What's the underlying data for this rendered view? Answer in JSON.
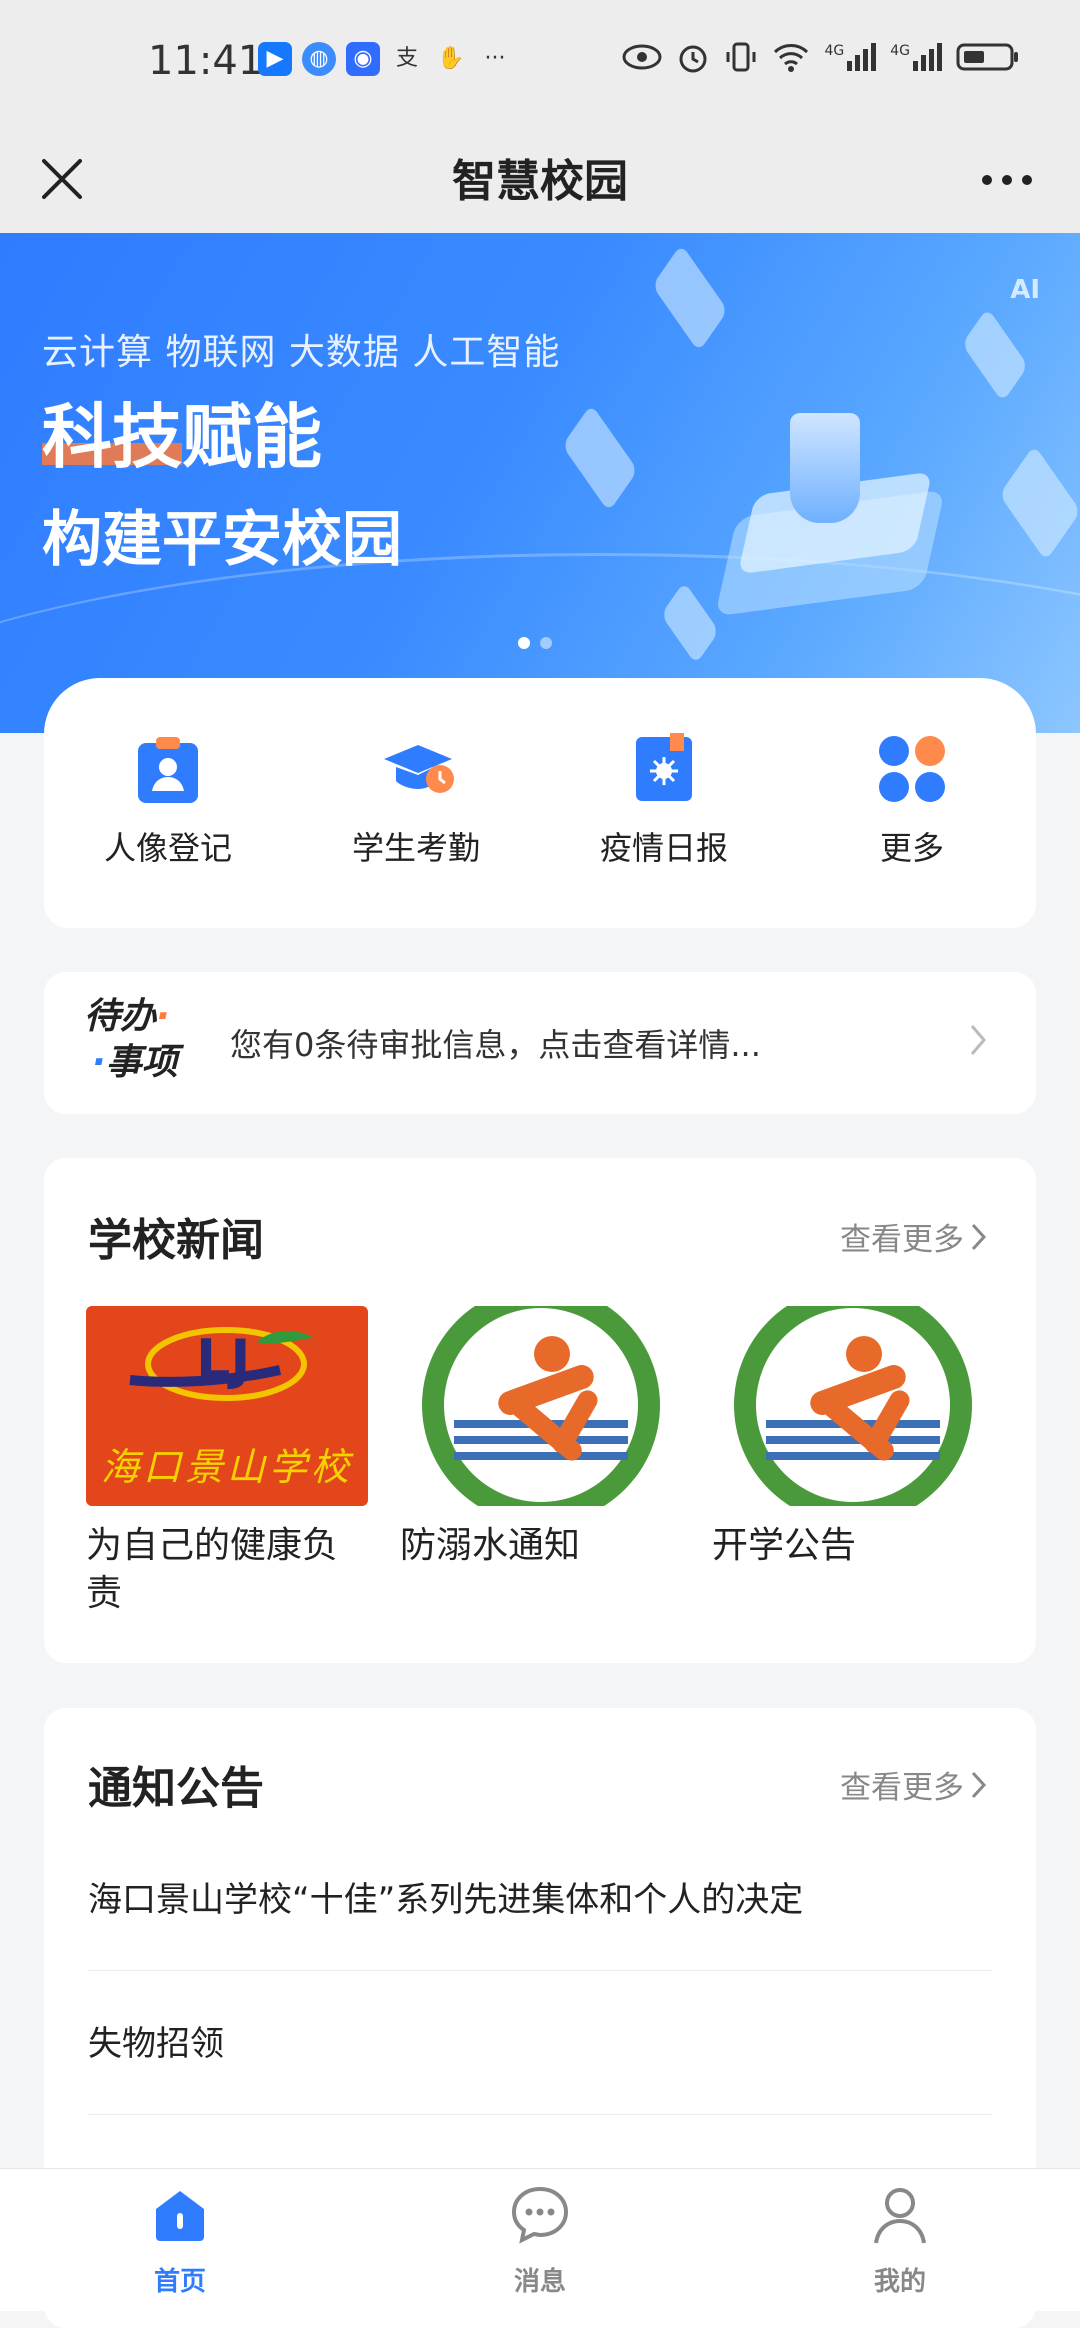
{
  "status_bar": {
    "time": "11:41",
    "left_icons": [
      "app-notification-icon",
      "browser-icon",
      "app-icon",
      "alipay-icon",
      "hand-icon",
      "more-dots"
    ],
    "right_icons": [
      "eye-icon",
      "alarm-icon",
      "vibrate-icon",
      "wifi-icon",
      "signal-4g-icon",
      "signal-4g-icon",
      "battery-icon"
    ],
    "overflow": "···",
    "net1": "4G",
    "net2": "4G"
  },
  "header": {
    "title": "智慧校园"
  },
  "banner": {
    "subtitle": "云计算 物联网 大数据 人工智能",
    "headline": "科技赋能",
    "headline2": "构建平安校园",
    "logo_text": "AI",
    "page_count": 2,
    "active_page": 1
  },
  "quick_menu": [
    {
      "label": "人像登记",
      "icon": "portrait-register-icon"
    },
    {
      "label": "学生考勤",
      "icon": "graduation-cap-clock-icon"
    },
    {
      "label": "疫情日报",
      "icon": "epidemic-report-icon"
    },
    {
      "label": "更多",
      "icon": "more-apps-icon"
    }
  ],
  "todo": {
    "logo_line1": "待办",
    "logo_line2": "事项",
    "text": "您有0条待审批信息，点击查看详情..."
  },
  "news": {
    "title": "学校新闻",
    "more": "查看更多",
    "items": [
      {
        "title": "为自己的健康负责",
        "image_text": "海口景山学校"
      },
      {
        "title": "防溺水通知"
      },
      {
        "title": "开学公告"
      }
    ]
  },
  "notices": {
    "title": "通知公告",
    "more": "查看更多",
    "items": [
      "海口景山学校“十佳”系列先进集体和个人的决定",
      "失物招领"
    ]
  },
  "tabbar": {
    "items": [
      {
        "label": "首页",
        "icon": "home-icon",
        "active": true
      },
      {
        "label": "消息",
        "icon": "message-icon",
        "active": false
      },
      {
        "label": "我的",
        "icon": "profile-icon",
        "active": false
      }
    ]
  },
  "colors": {
    "accent": "#2f7cff",
    "orange": "#ff7a3c"
  }
}
